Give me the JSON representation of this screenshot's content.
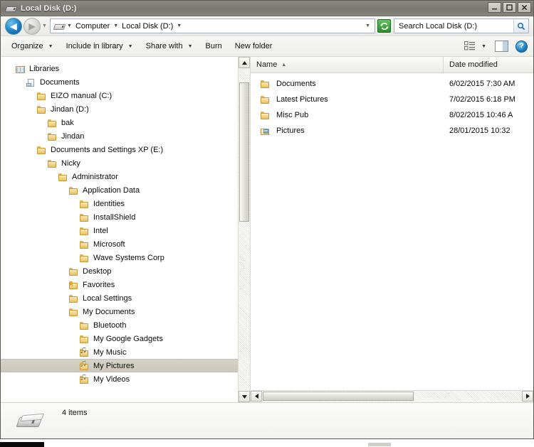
{
  "window": {
    "title": "Local Disk (D:)",
    "title_icon": "drive-icon",
    "minimize_label": "_",
    "maximize_label": "□",
    "close_label": "✕"
  },
  "address_bar": {
    "back_label": "◀",
    "forward_label": "▶",
    "recent_caret": "▼",
    "drive_icon": "drive-icon",
    "crumbs": [
      {
        "label": "Computer",
        "caret": "▼"
      },
      {
        "label": "Local Disk (D:)",
        "caret": "▼"
      }
    ],
    "end_caret": "▼",
    "refresh_icon": "refresh-icon",
    "search": {
      "placeholder": "Search Local Disk (D:)",
      "value": "",
      "icon": "search-icon"
    }
  },
  "command_bar": {
    "items": [
      {
        "label": "Organize",
        "caret": "▼"
      },
      {
        "label": "Include in library",
        "caret": "▼"
      },
      {
        "label": "Share with",
        "caret": "▼"
      },
      {
        "label": "Burn",
        "caret": ""
      },
      {
        "label": "New folder",
        "caret": ""
      }
    ],
    "view_icon": "view-list-icon",
    "view_caret": "▼",
    "preview_pane_icon": "preview-pane-icon",
    "help_label": "?"
  },
  "nav_pane": {
    "scroll": {
      "up_label": "▲",
      "down_label": "▼"
    },
    "tree": [
      {
        "label": "Libraries",
        "indent": 0,
        "icon": "library",
        "selected": false
      },
      {
        "label": "Documents",
        "indent": 1,
        "icon": "doclib",
        "selected": false
      },
      {
        "label": "EIZO manual (C:)",
        "indent": 2,
        "icon": "folder",
        "selected": false
      },
      {
        "label": "Jindan (D:)",
        "indent": 2,
        "icon": "folder",
        "selected": false
      },
      {
        "label": "bak",
        "indent": 3,
        "icon": "folder",
        "selected": false
      },
      {
        "label": "Jindan",
        "indent": 3,
        "icon": "folder",
        "selected": false
      },
      {
        "label": "Documents and Settings XP (E:)",
        "indent": 2,
        "icon": "folder",
        "selected": false
      },
      {
        "label": "Nicky",
        "indent": 3,
        "icon": "folder",
        "selected": false
      },
      {
        "label": "Administrator",
        "indent": 4,
        "icon": "folder",
        "selected": false
      },
      {
        "label": "Application Data",
        "indent": 5,
        "icon": "folder",
        "selected": false
      },
      {
        "label": "Identities",
        "indent": 6,
        "icon": "folder",
        "selected": false
      },
      {
        "label": "InstallShield",
        "indent": 6,
        "icon": "folder",
        "selected": false
      },
      {
        "label": "Intel",
        "indent": 6,
        "icon": "folder",
        "selected": false
      },
      {
        "label": "Microsoft",
        "indent": 6,
        "icon": "folder",
        "selected": false
      },
      {
        "label": "Wave Systems Corp",
        "indent": 6,
        "icon": "folder",
        "selected": false
      },
      {
        "label": "Desktop",
        "indent": 5,
        "icon": "folder",
        "selected": false
      },
      {
        "label": "Favorites",
        "indent": 5,
        "icon": "fav",
        "selected": false
      },
      {
        "label": "Local Settings",
        "indent": 5,
        "icon": "folder",
        "selected": false
      },
      {
        "label": "My Documents",
        "indent": 5,
        "icon": "folder",
        "selected": false
      },
      {
        "label": "Bluetooth",
        "indent": 6,
        "icon": "folder",
        "selected": false
      },
      {
        "label": "My Google Gadgets",
        "indent": 6,
        "icon": "folder",
        "selected": false
      },
      {
        "label": "My Music",
        "indent": 6,
        "icon": "media",
        "selected": false
      },
      {
        "label": "My Pictures",
        "indent": 6,
        "icon": "pic",
        "selected": true
      },
      {
        "label": "My Videos",
        "indent": 6,
        "icon": "pic",
        "selected": false
      }
    ]
  },
  "file_list": {
    "columns": [
      {
        "label": "Name",
        "sort_caret": "▲"
      },
      {
        "label": "Date modified",
        "sort_caret": ""
      }
    ],
    "rows": [
      {
        "name": "Documents",
        "date": "6/02/2015 7:30 AM",
        "icon": "folder"
      },
      {
        "name": "Latest Pictures",
        "date": "7/02/2015 6:18 PM",
        "icon": "folder"
      },
      {
        "name": "Misc Pub",
        "date": "8/02/2015 10:46 A",
        "icon": "folder"
      },
      {
        "name": "Pictures",
        "date": "28/01/2015 10:32",
        "icon": "pictures"
      }
    ],
    "hscroll": {
      "left_label": "◀",
      "right_label": "▶"
    }
  },
  "details_pane": {
    "icon": "drive-icon",
    "text": "4 items"
  }
}
